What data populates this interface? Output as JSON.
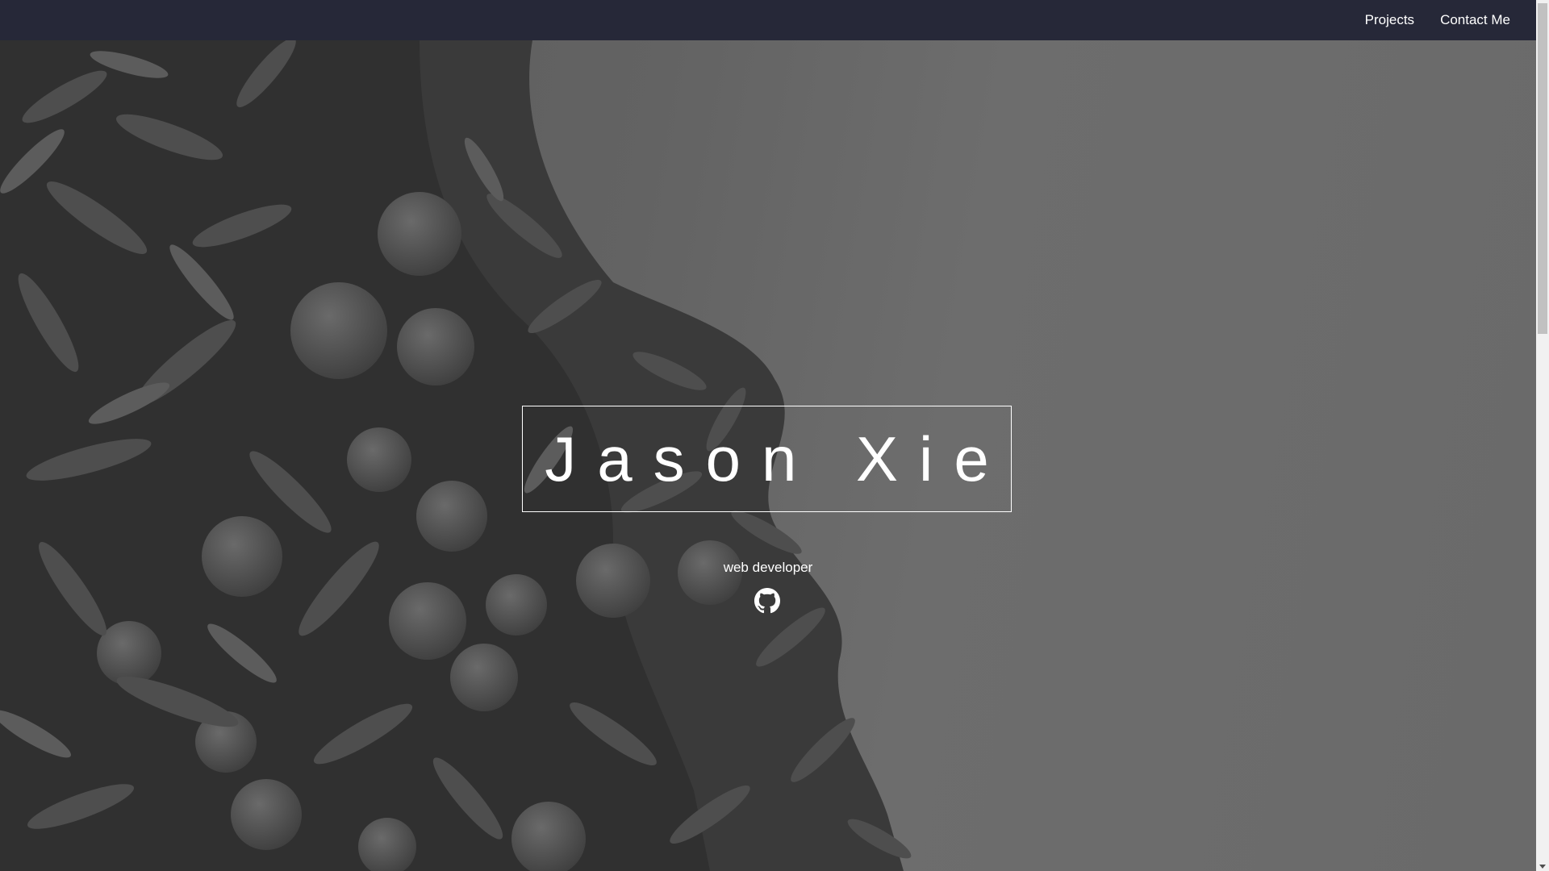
{
  "nav": {
    "links": [
      {
        "label": "Projects"
      },
      {
        "label": "Contact Me"
      }
    ],
    "background": "#262838"
  },
  "hero": {
    "title": "Jason Xie",
    "subtitle": "web developer",
    "social_icon": "github-icon"
  },
  "colors": {
    "text": "#ffffff",
    "overlay": "#6b6b6b"
  }
}
